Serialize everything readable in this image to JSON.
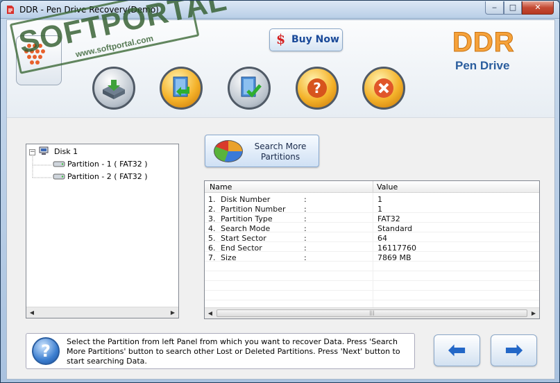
{
  "window": {
    "title": "DDR - Pen Drive Recovery(Demo)"
  },
  "titlebar_buttons": {
    "minimize": "‒",
    "maximize": "□",
    "close": "✕"
  },
  "header": {
    "buy_now": {
      "symbol": "$",
      "label": "Buy Now"
    },
    "brand": {
      "line1": "DDR",
      "line2": "Pen Drive"
    },
    "toolbar_icons": [
      "disk-icon",
      "save-recover-icon",
      "check-icon",
      "help-icon",
      "exit-icon"
    ]
  },
  "watermark": {
    "main": "SOFTPORTAL",
    "sub": "www.softportal.com"
  },
  "tree": {
    "root": "Disk 1",
    "partitions": [
      "Partition - 1 ( FAT32 )",
      "Partition - 2 ( FAT32 )"
    ]
  },
  "search_button": {
    "label": "Search More\nPartitions"
  },
  "details": {
    "headers": [
      "Name",
      "Value"
    ],
    "rows": [
      {
        "num": "1.",
        "name": "Disk Number",
        "sep": ":",
        "value": "1"
      },
      {
        "num": "2.",
        "name": "Partition Number",
        "sep": ":",
        "value": "1"
      },
      {
        "num": "3.",
        "name": "Partition Type",
        "sep": ":",
        "value": "FAT32"
      },
      {
        "num": "4.",
        "name": "Search Mode",
        "sep": ":",
        "value": "Standard"
      },
      {
        "num": "5.",
        "name": "Start Sector",
        "sep": ":",
        "value": "64"
      },
      {
        "num": "6.",
        "name": "End Sector",
        "sep": ":",
        "value": "16117760"
      },
      {
        "num": "7.",
        "name": "Size",
        "sep": ":",
        "value": "7869 MB"
      }
    ]
  },
  "status": {
    "text": "Select the Partition from left Panel from which you want to recover Data. Press 'Search More Partitions' button to search other Lost or Deleted Partitions. Press 'Next' button to start searching Data."
  },
  "nav": {
    "back": "⬅",
    "next": "➡"
  },
  "colors": {
    "brand_orange": "#f6a23a",
    "brand_blue": "#2a5d9d",
    "buy_dollar": "#d62020"
  }
}
